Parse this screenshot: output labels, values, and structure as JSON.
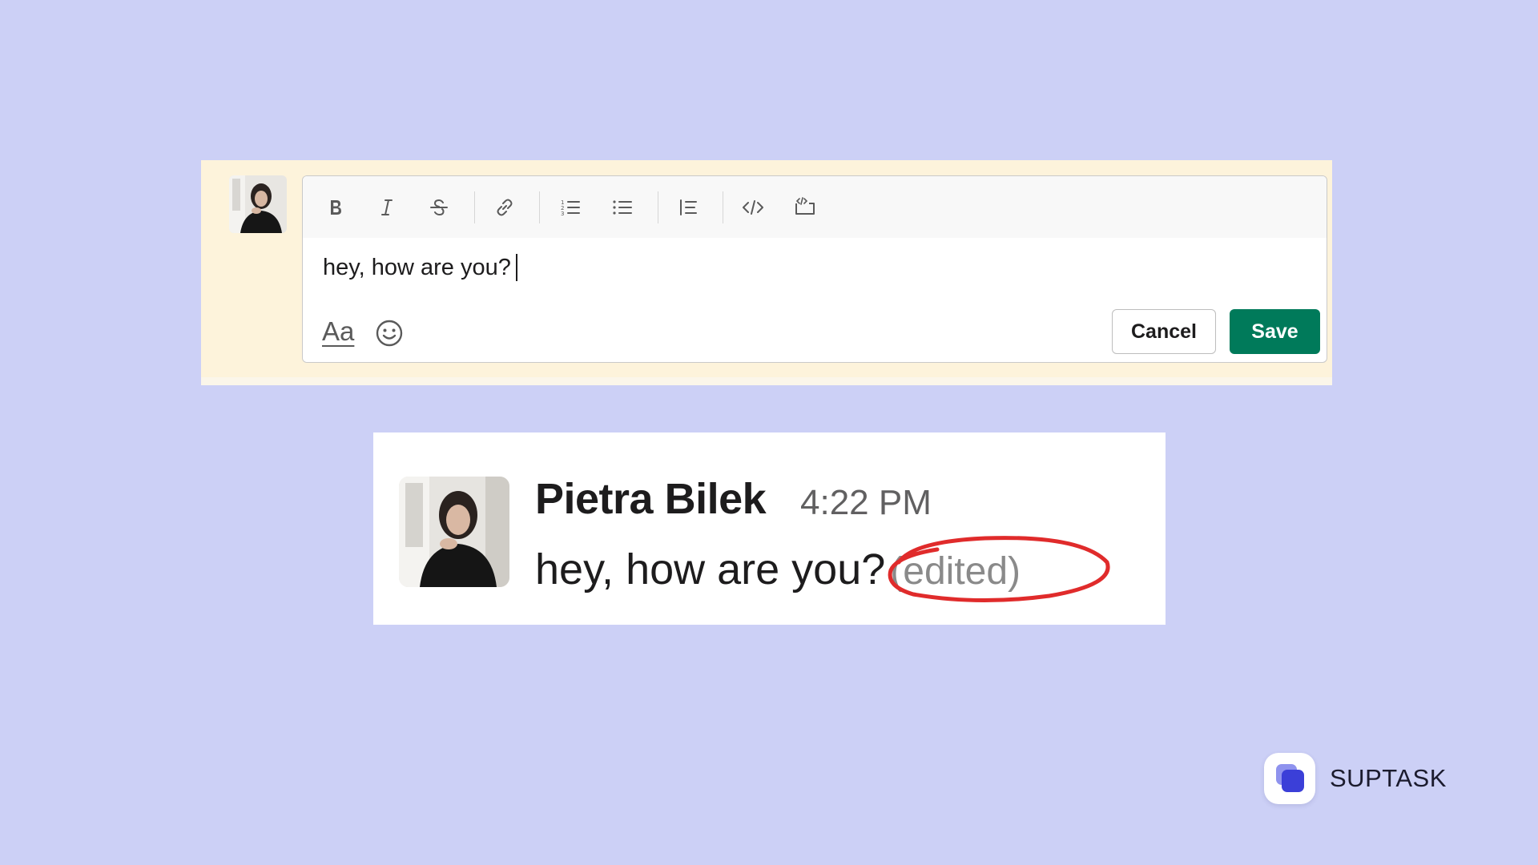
{
  "editor": {
    "toolbar": {
      "items": [
        {
          "name": "bold-icon",
          "label": "Bold"
        },
        {
          "name": "italic-icon",
          "label": "Italic"
        },
        {
          "name": "strikethrough-icon",
          "label": "Strikethrough"
        },
        {
          "name": "link-icon",
          "label": "Link"
        },
        {
          "name": "ordered-list-icon",
          "label": "Ordered list"
        },
        {
          "name": "bulleted-list-icon",
          "label": "Bulleted list"
        },
        {
          "name": "blockquote-icon",
          "label": "Blockquote"
        },
        {
          "name": "code-icon",
          "label": "Code"
        },
        {
          "name": "code-block-icon",
          "label": "Code block"
        }
      ]
    },
    "message_value": "hey, how are you?",
    "format_toggle_label": "Aa",
    "cancel_label": "Cancel",
    "save_label": "Save"
  },
  "message": {
    "author": "Pietra Bilek",
    "time": "4:22 PM",
    "text": "hey, how are you?",
    "edited_label": "(edited)"
  },
  "brand": {
    "name": "SUPTASK"
  },
  "colors": {
    "background": "#ccd0f6",
    "editor_highlight": "#fdf3db",
    "save_button": "#007a5a",
    "annotation_circle": "#e02b2b",
    "brand_icon": "#3b3fd8"
  }
}
